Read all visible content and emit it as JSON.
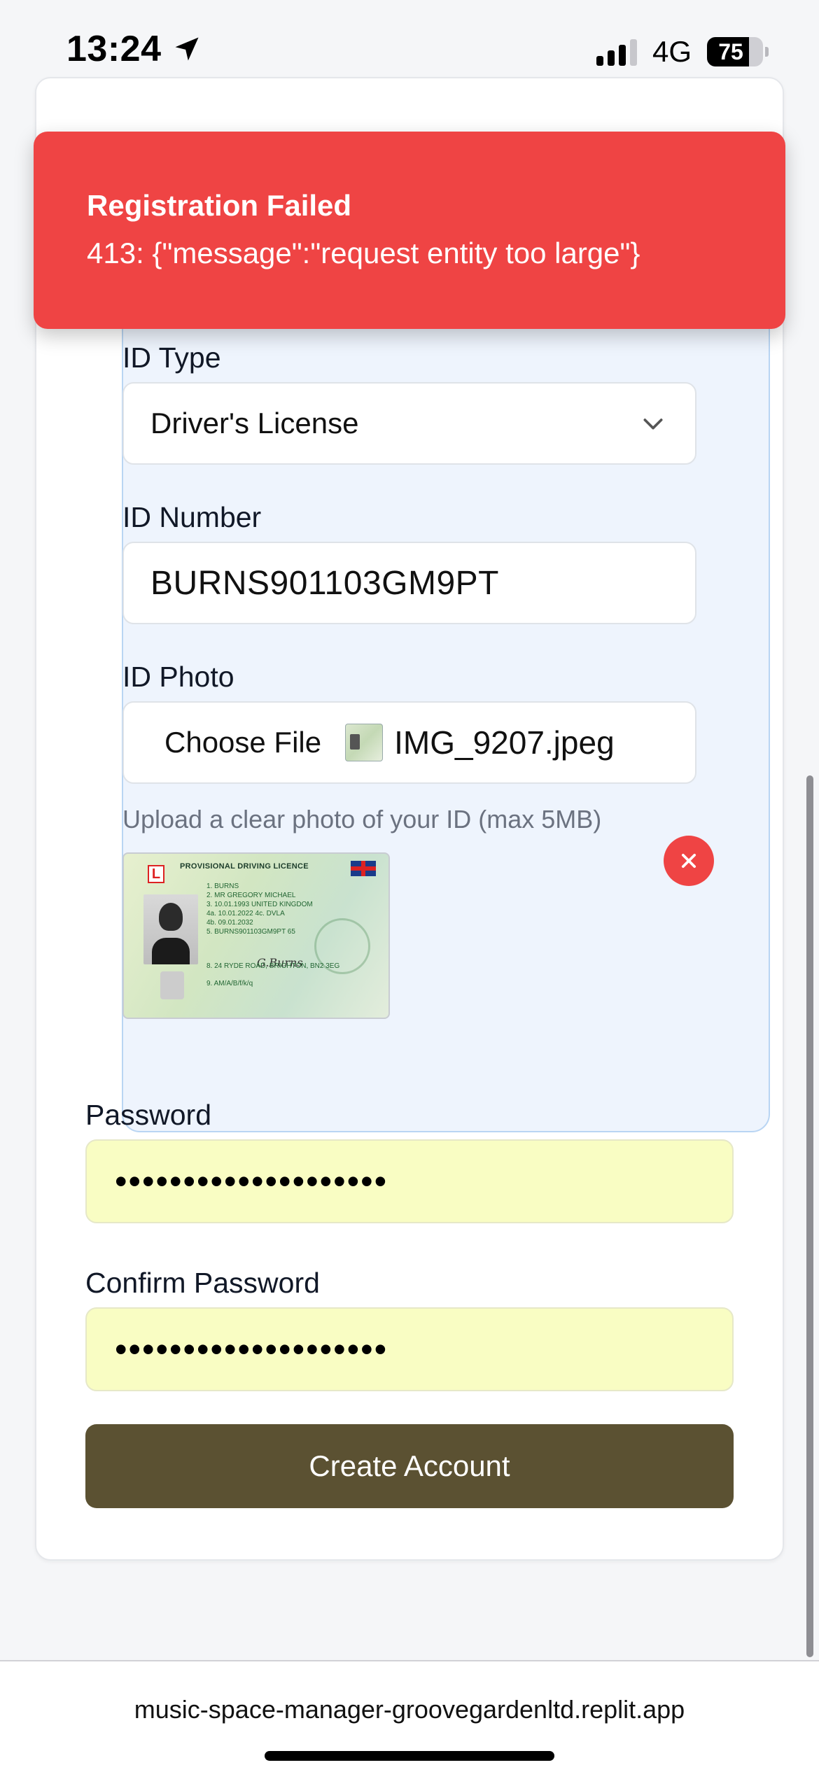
{
  "status_bar": {
    "time": "13:24",
    "network": "4G",
    "battery_level": "75",
    "battery_fraction": 0.75
  },
  "toast": {
    "title": "Registration Failed",
    "message": "413: {\"message\":\"request entity too large\"}",
    "color": "#ef4444"
  },
  "form": {
    "id_type_label": "ID Type",
    "id_type_value": "Driver's License",
    "id_number_label": "ID Number",
    "id_number_value": "BURNS901103GM9PT",
    "id_photo_label": "ID Photo",
    "choose_file_label": "Choose File",
    "file_name": "IMG_9207.jpeg",
    "upload_hint": "Upload a clear photo of your ID (max 5MB)",
    "password_label": "Password",
    "password_value": "••••••••••••••••••••",
    "confirm_password_label": "Confirm Password",
    "confirm_password_value": "••••••••••••••••••••",
    "submit_label": "Create Account",
    "submit_color": "#5b5132"
  },
  "license_preview": {
    "title": "PROVISIONAL DRIVING LICENCE",
    "badge": "L",
    "lines": [
      "1.  BURNS",
      "2.  MR GREGORY MICHAEL",
      "3.  10.01.1993 UNITED KINGDOM",
      "4a. 10.01.2022  4c. DVLA",
      "4b. 09.01.2032",
      "5.  BURNS901103GM9PT 65",
      "8.  24 RYDE ROAD, BRIGHTON, BN2 3EG",
      "9.  AM/A/B/f/k/q"
    ]
  },
  "browser": {
    "url": "music-space-manager-groovegardenltd.replit.app"
  }
}
